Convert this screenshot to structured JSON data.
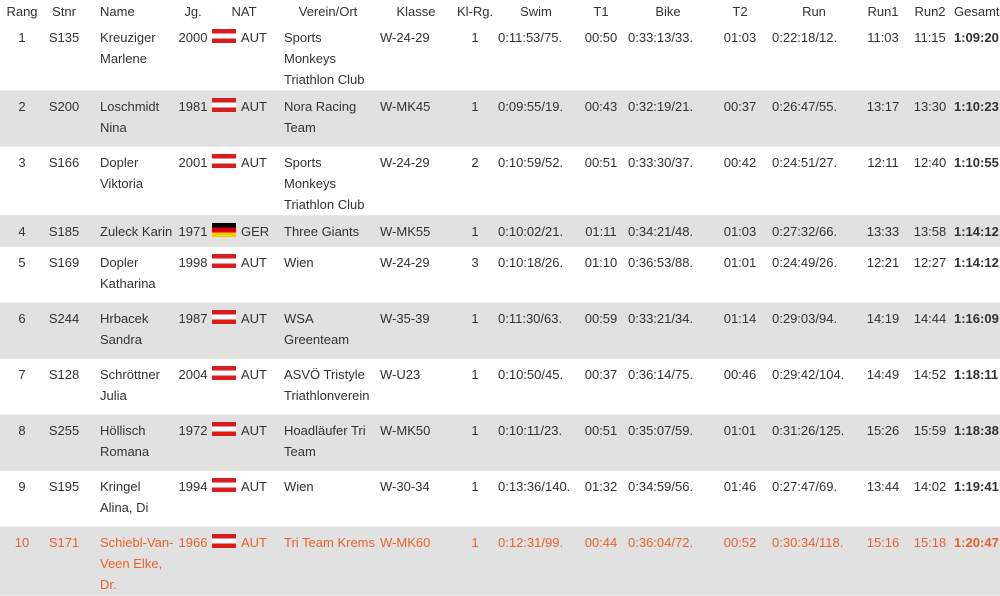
{
  "columns": [
    "Rang",
    "Stnr",
    "Name",
    "Jg.",
    "NAT",
    "Verein/Ort",
    "Klasse",
    "Kl-Rg.",
    "Swim",
    "T1",
    "Bike",
    "T2",
    "Run",
    "Run1",
    "Run2",
    "Gesamt"
  ],
  "rows": [
    {
      "rang": "1",
      "stnr": "S135",
      "name": "Kreuziger Marlene",
      "jg": "2000",
      "flag": "aut",
      "nat": "AUT",
      "verein": "Sports Monkeys Triathlon Club",
      "klasse": "W-24-29",
      "klrg": "1",
      "swim": "0:11:53/75.",
      "t1": "00:50",
      "bike": "0:33:13/33.",
      "t2": "01:03",
      "run": "0:22:18/12.",
      "run1": "11:03",
      "run2": "11:15",
      "gesamt": "1:09:20"
    },
    {
      "rang": "2",
      "stnr": "S200",
      "name": "Loschmidt Nina",
      "jg": "1981",
      "flag": "aut",
      "nat": "AUT",
      "verein": "Nora Racing Team",
      "klasse": "W-MK45",
      "klrg": "1",
      "swim": "0:09:55/19.",
      "t1": "00:43",
      "bike": "0:32:19/21.",
      "t2": "00:37",
      "run": "0:26:47/55.",
      "run1": "13:17",
      "run2": "13:30",
      "gesamt": "1:10:23"
    },
    {
      "rang": "3",
      "stnr": "S166",
      "name": "Dopler Viktoria",
      "jg": "2001",
      "flag": "aut",
      "nat": "AUT",
      "verein": "Sports Monkeys Triathlon Club",
      "klasse": "W-24-29",
      "klrg": "2",
      "swim": "0:10:59/52.",
      "t1": "00:51",
      "bike": "0:33:30/37.",
      "t2": "00:42",
      "run": "0:24:51/27.",
      "run1": "12:11",
      "run2": "12:40",
      "gesamt": "1:10:55"
    },
    {
      "rang": "4",
      "stnr": "S185",
      "name": "Zuleck Karin",
      "jg": "1971",
      "flag": "ger",
      "nat": "GER",
      "verein": "Three Giants",
      "klasse": "W-MK55",
      "klrg": "1",
      "swim": "0:10:02/21.",
      "t1": "01:11",
      "bike": "0:34:21/48.",
      "t2": "01:03",
      "run": "0:27:32/66.",
      "run1": "13:33",
      "run2": "13:58",
      "gesamt": "1:14:12"
    },
    {
      "rang": "5",
      "stnr": "S169",
      "name": "Dopler Katharina",
      "jg": "1998",
      "flag": "aut",
      "nat": "AUT",
      "verein": "Wien",
      "klasse": "W-24-29",
      "klrg": "3",
      "swim": "0:10:18/26.",
      "t1": "01:10",
      "bike": "0:36:53/88.",
      "t2": "01:01",
      "run": "0:24:49/26.",
      "run1": "12:21",
      "run2": "12:27",
      "gesamt": "1:14:12"
    },
    {
      "rang": "6",
      "stnr": "S244",
      "name": "Hrbacek Sandra",
      "jg": "1987",
      "flag": "aut",
      "nat": "AUT",
      "verein": "WSA Greenteam",
      "klasse": "W-35-39",
      "klrg": "1",
      "swim": "0:11:30/63.",
      "t1": "00:59",
      "bike": "0:33:21/34.",
      "t2": "01:14",
      "run": "0:29:03/94.",
      "run1": "14:19",
      "run2": "14:44",
      "gesamt": "1:16:09"
    },
    {
      "rang": "7",
      "stnr": "S128",
      "name": "Schröttner Julia",
      "jg": "2004",
      "flag": "aut",
      "nat": "AUT",
      "verein": "ASVÖ Tristyle Triathlonverein",
      "klasse": "W-U23",
      "klrg": "1",
      "swim": "0:10:50/45.",
      "t1": "00:37",
      "bike": "0:36:14/75.",
      "t2": "00:46",
      "run": "0:29:42/104.",
      "run1": "14:49",
      "run2": "14:52",
      "gesamt": "1:18:11"
    },
    {
      "rang": "8",
      "stnr": "S255",
      "name": "Höllisch Romana",
      "jg": "1972",
      "flag": "aut",
      "nat": "AUT",
      "verein": "Hoadläufer Tri Team",
      "klasse": "W-MK50",
      "klrg": "1",
      "swim": "0:10:11/23.",
      "t1": "00:51",
      "bike": "0:35:07/59.",
      "t2": "01:01",
      "run": "0:31:26/125.",
      "run1": "15:26",
      "run2": "15:59",
      "gesamt": "1:18:38"
    },
    {
      "rang": "9",
      "stnr": "S195",
      "name": "Kringel Alina, Di",
      "jg": "1994",
      "flag": "aut",
      "nat": "AUT",
      "verein": "Wien",
      "klasse": "W-30-34",
      "klrg": "1",
      "swim": "0:13:36/140.",
      "t1": "01:32",
      "bike": "0:34:59/56.",
      "t2": "01:46",
      "run": "0:27:47/69.",
      "run1": "13:44",
      "run2": "14:02",
      "gesamt": "1:19:41"
    },
    {
      "rang": "10",
      "stnr": "S171",
      "name": "Schiebl-Van-Veen Elke, Dr.",
      "jg": "1966",
      "flag": "aut",
      "nat": "AUT",
      "verein": "Tri Team Krems",
      "klasse": "W-MK60",
      "klrg": "1",
      "swim": "0:12:31/99.",
      "t1": "00:44",
      "bike": "0:36:04/72.",
      "t2": "00:52",
      "run": "0:30:34/118.",
      "run1": "15:16",
      "run2": "15:18",
      "gesamt": "1:20:47",
      "highlight": true
    }
  ],
  "colors": {
    "highlight": "#e8632b",
    "stripe": "#e1e1e1"
  }
}
